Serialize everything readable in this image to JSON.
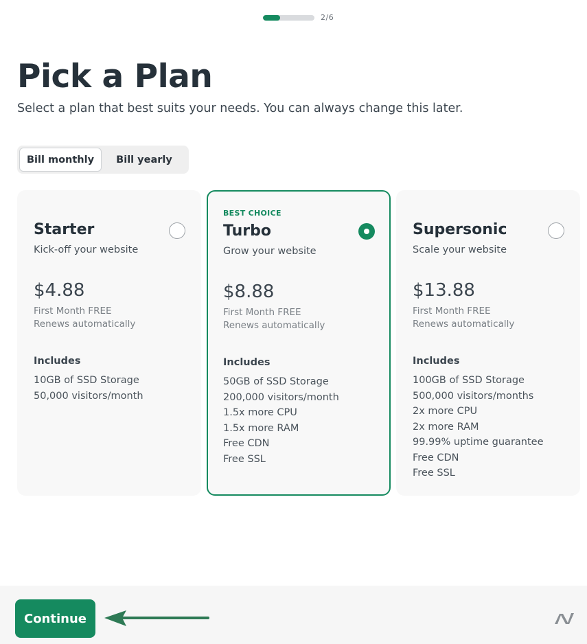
{
  "progress": {
    "text": "2/6",
    "fraction": 0.33
  },
  "header": {
    "title": "Pick a Plan",
    "subtitle": "Select a plan that best suits your needs. You can always change this later."
  },
  "billing": {
    "monthly_label": "Bill monthly",
    "yearly_label": "Bill yearly",
    "selected": "monthly"
  },
  "plans": [
    {
      "badge": "",
      "name": "Starter",
      "tagline": "Kick-off your website",
      "price": "$4.88",
      "note1": "First Month FREE",
      "note2": "Renews automatically",
      "includes_label": "Includes",
      "selected": false,
      "features": [
        "10GB of SSD Storage",
        "50,000 visitors/month"
      ]
    },
    {
      "badge": "BEST CHOICE",
      "name": "Turbo",
      "tagline": "Grow your website",
      "price": "$8.88",
      "note1": "First Month FREE",
      "note2": "Renews automatically",
      "includes_label": "Includes",
      "selected": true,
      "features": [
        "50GB of SSD Storage",
        "200,000 visitors/month",
        "1.5x more CPU",
        "1.5x more RAM",
        "Free CDN",
        "Free SSL"
      ]
    },
    {
      "badge": "",
      "name": "Supersonic",
      "tagline": "Scale your website",
      "price": "$13.88",
      "note1": "First Month FREE",
      "note2": "Renews automatically",
      "includes_label": "Includes",
      "selected": false,
      "features": [
        "100GB of SSD Storage",
        "500,000 visitors/months",
        "2x more CPU",
        "2x more RAM",
        "99.99% uptime guarantee",
        "Free CDN",
        "Free SSL"
      ]
    }
  ],
  "footer": {
    "continue_label": "Continue",
    "logo_icon": "namecheap-logo-icon",
    "arrow_icon": "left-arrow-annotation-icon"
  },
  "colors": {
    "accent": "#158a5f",
    "arrow": "#2e7a55",
    "logo": "#8a8f94"
  }
}
